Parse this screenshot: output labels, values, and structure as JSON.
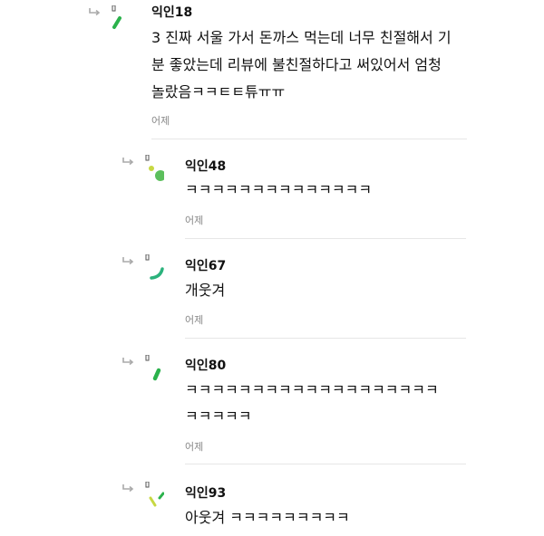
{
  "comments": [
    {
      "author": "익인18",
      "lines": [
        "3 진짜 서울 가서 돈까스 먹는데 너무 친절해서 기",
        "분 좋았는데 리뷰에 불친절하다고 써있어서 엄청",
        "놀랐음ㅋㅋㅌㅌ튜ㅠㅠ"
      ],
      "time": "어제",
      "avatar_icon": "green-dash-avatar-icon",
      "colors": [
        "#2bb24c"
      ]
    },
    {
      "author": "익인48",
      "lines": [
        "ㅋㅋㅋㅋㅋㅋㅋㅋㅋㅋㅋㅋㅋㅋ"
      ],
      "time": "어제",
      "avatar_icon": "green-dots-avatar-icon",
      "colors": [
        "#c7d842",
        "#5cbf5c"
      ]
    },
    {
      "author": "익인67",
      "lines": [
        "개웃겨"
      ],
      "time": "어제",
      "avatar_icon": "green-arc-avatar-icon",
      "colors": [
        "#2bb27c"
      ]
    },
    {
      "author": "익인80",
      "lines": [
        "ㅋㅋㅋㅋㅋㅋㅋㅋㅋㅋㅋㅋㅋㅋㅋㅋㅋㅋㅋ",
        "ㅋㅋㅋㅋㅋ"
      ],
      "time": "어제",
      "avatar_icon": "green-slash-avatar-icon",
      "colors": [
        "#2bb24c"
      ]
    },
    {
      "author": "익인93",
      "lines": [
        "아웃겨 ㅋㅋㅋㅋㅋㅋㅋㅋㅋ"
      ],
      "time": "",
      "avatar_icon": "yellow-green-dashes-avatar-icon",
      "colors": [
        "#c7d842",
        "#2bb24c"
      ]
    }
  ]
}
